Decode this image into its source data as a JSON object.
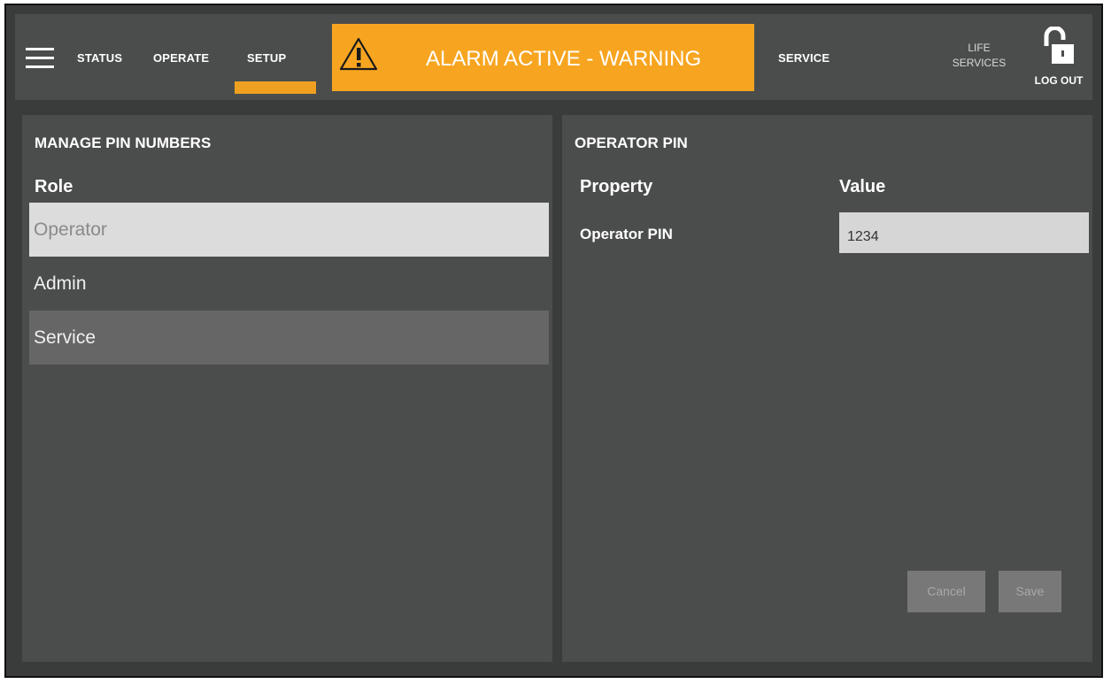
{
  "nav": {
    "tabs": [
      {
        "label": "STATUS"
      },
      {
        "label": "OPERATE"
      },
      {
        "label": "SETUP",
        "active": true
      },
      {
        "label": "SERVICE"
      }
    ],
    "alarm_text": "ALARM ACTIVE - WARNING",
    "life_services_line1": "LIFE",
    "life_services_line2": "SERVICES",
    "logout_label": "LOG OUT",
    "menu_icon": "hamburger-icon",
    "alarm_icon": "warning-triangle-icon",
    "logout_icon": "unlocked-padlock-icon"
  },
  "left_panel": {
    "title": "MANAGE PIN NUMBERS",
    "column_header": "Role",
    "roles": [
      {
        "label": "Operator",
        "state": "selected"
      },
      {
        "label": "Admin",
        "state": "normal"
      },
      {
        "label": "Service",
        "state": "highlighted"
      }
    ]
  },
  "right_panel": {
    "title": "OPERATOR PIN",
    "property_header": "Property",
    "value_header": "Value",
    "property_label": "Operator PIN",
    "pin_value": "1234",
    "cancel_label": "Cancel",
    "save_label": "Save"
  },
  "colors": {
    "accent_orange": "#f7a520",
    "panel_bg": "#4b4d4c",
    "frame_bg": "#3a3c3b",
    "selected_row": "#dcdcdc",
    "highlight_row": "#666666"
  }
}
